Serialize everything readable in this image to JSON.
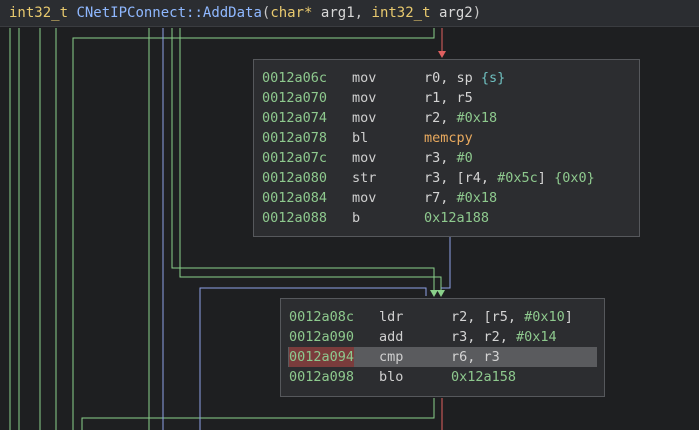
{
  "header": {
    "ret_type": "int32_t",
    "func_name": "CNetIPConnect::AddData",
    "open_paren": "(",
    "arg1_type": "char*",
    "arg1_name": "arg1",
    "comma": ",",
    "arg2_type": "int32_t",
    "arg2_name": "arg2",
    "close_paren": ")"
  },
  "block1": {
    "rows": [
      {
        "addr": "0012a06c",
        "mn": "mov",
        "ops": [
          {
            "t": "r0, sp ",
            "c": ""
          },
          {
            "t": "{s}",
            "c": "t"
          }
        ]
      },
      {
        "addr": "0012a070",
        "mn": "mov",
        "ops": [
          {
            "t": "r1, r5",
            "c": ""
          }
        ]
      },
      {
        "addr": "0012a074",
        "mn": "mov",
        "ops": [
          {
            "t": "r2, ",
            "c": ""
          },
          {
            "t": "#0x18",
            "c": "g"
          }
        ]
      },
      {
        "addr": "0012a078",
        "mn": "bl",
        "ops": [
          {
            "t": "memcpy",
            "c": "y"
          }
        ]
      },
      {
        "addr": "0012a07c",
        "mn": "mov",
        "ops": [
          {
            "t": "r3, ",
            "c": ""
          },
          {
            "t": "#0",
            "c": "g"
          }
        ]
      },
      {
        "addr": "0012a080",
        "mn": "str",
        "ops": [
          {
            "t": "r3, [r4,  ",
            "c": ""
          },
          {
            "t": "#0x5c",
            "c": "g"
          },
          {
            "t": "]  ",
            "c": ""
          },
          {
            "t": "{0x0}",
            "c": "g"
          }
        ]
      },
      {
        "addr": "0012a084",
        "mn": "mov",
        "ops": [
          {
            "t": "r7, ",
            "c": ""
          },
          {
            "t": "#0x18",
            "c": "g"
          }
        ]
      },
      {
        "addr": "0012a088",
        "mn": "b",
        "ops": [
          {
            "t": "0x12a188",
            "c": "g"
          }
        ]
      }
    ]
  },
  "block2": {
    "rows": [
      {
        "addr": "0012a08c",
        "mn": "ldr",
        "ops": [
          {
            "t": "r2, [r5,  ",
            "c": ""
          },
          {
            "t": "#0x10",
            "c": "g"
          },
          {
            "t": "]",
            "c": ""
          }
        ]
      },
      {
        "addr": "0012a090",
        "mn": "add",
        "ops": [
          {
            "t": "r3, r2, ",
            "c": ""
          },
          {
            "t": "#0x14",
            "c": "g"
          }
        ]
      },
      {
        "addr": "0012a094",
        "mn": "cmp",
        "ops": [
          {
            "t": "r6, r3",
            "c": ""
          }
        ],
        "highlight": true
      },
      {
        "addr": "0012a098",
        "mn": "blo",
        "ops": [
          {
            "t": "0x12a158",
            "c": "g"
          }
        ]
      }
    ]
  },
  "colors": {
    "edge_green": "#8ad08a",
    "edge_blue": "#8ea0e6",
    "edge_red": "#e06060",
    "background": "#1e1f21"
  }
}
